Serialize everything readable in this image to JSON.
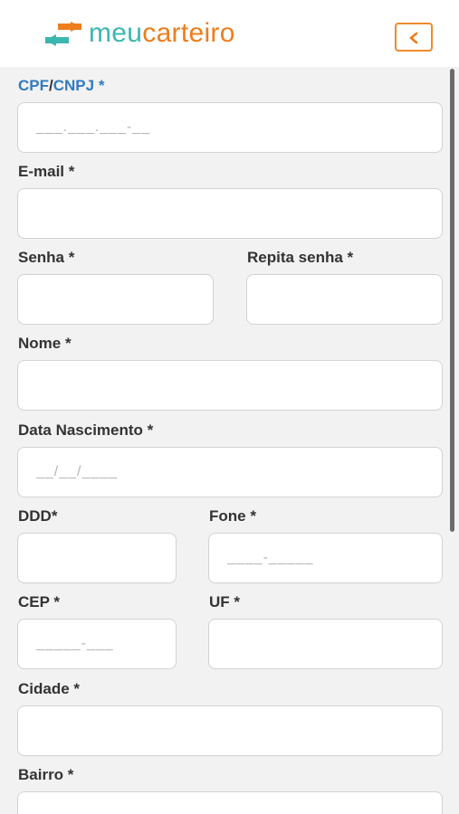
{
  "header": {
    "logo_part1": "meu",
    "logo_part2": "carteiro",
    "back_label": "<"
  },
  "form": {
    "cpf_label_a": "CPF",
    "cpf_label_sep": "/",
    "cpf_label_b": "CNPJ",
    "cpf_label_star": " *",
    "cpf_placeholder": "___.___.___-__",
    "email_label": "E-mail *",
    "senha_label": "Senha *",
    "repita_label": "Repita senha *",
    "nome_label": "Nome *",
    "nascimento_label": "Data Nascimento *",
    "nascimento_placeholder": "__/__/____",
    "ddd_label": "DDD*",
    "fone_label": "Fone *",
    "fone_placeholder": "____-_____",
    "cep_label": "CEP *",
    "cep_placeholder": "_____-___",
    "uf_label": "UF *",
    "cidade_label": "Cidade *",
    "bairro_label": "Bairro *"
  },
  "colors": {
    "brand_teal": "#3bb7b0",
    "brand_orange": "#ee7d1c",
    "label_blue": "#2f7bbf",
    "background": "#f2f2f2"
  }
}
